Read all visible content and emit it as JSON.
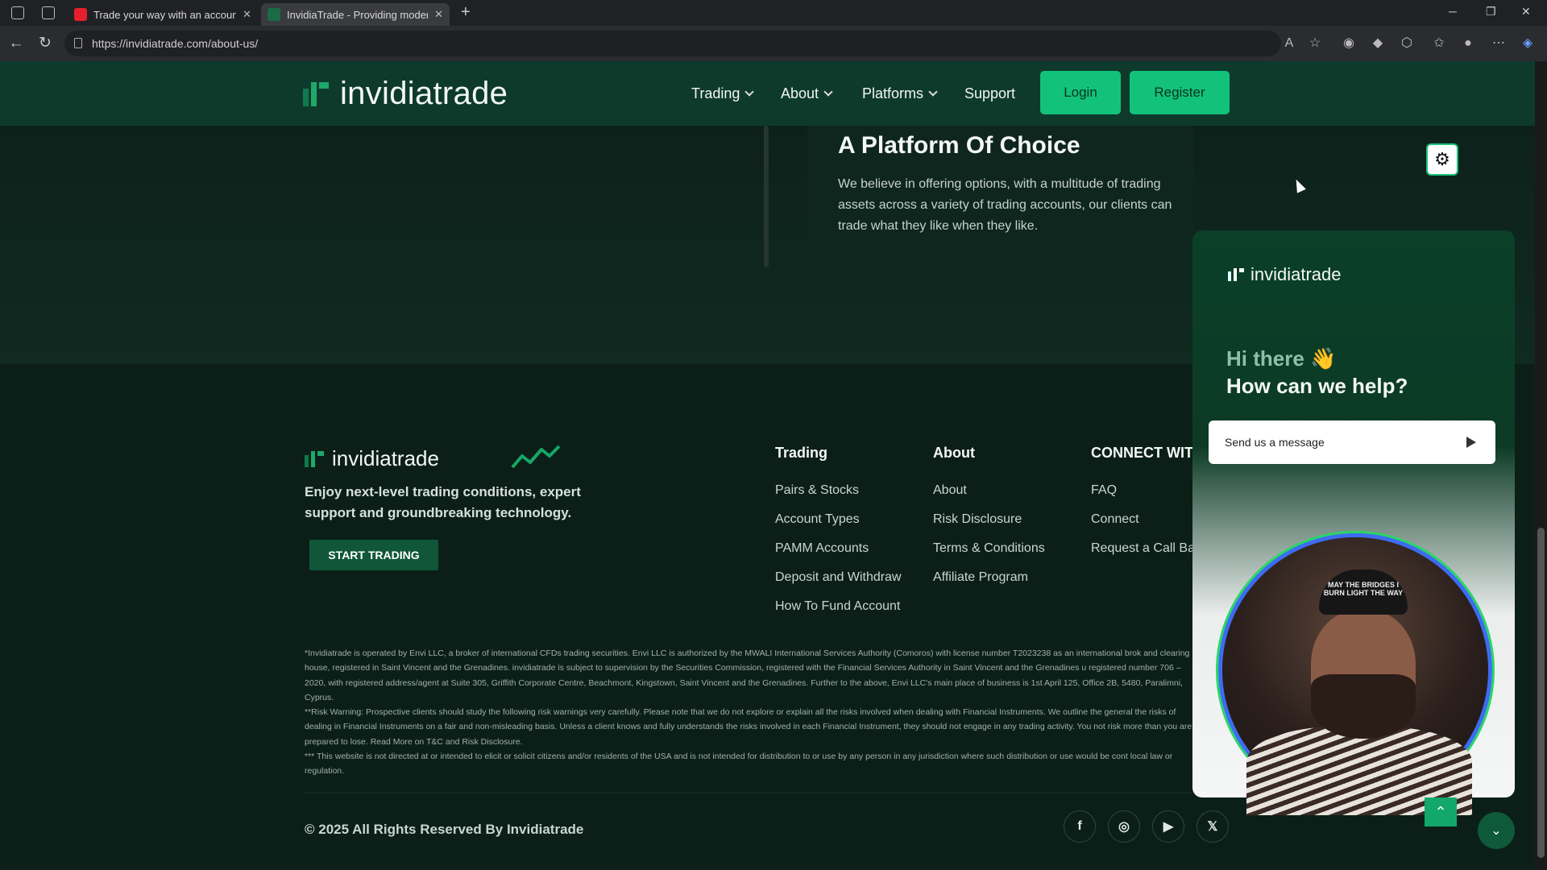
{
  "browser": {
    "tabs": [
      {
        "title": "Trade your way with an account a",
        "favicon_color": "#e4202c"
      },
      {
        "title": "InvidiaTrade - Providing modern",
        "favicon_color": "#1a6b46"
      }
    ],
    "url": "https://invidiatrade.com/about-us/"
  },
  "header": {
    "brand": "invidiatrade",
    "nav": [
      "Trading",
      "About",
      "Platforms",
      "Support"
    ],
    "login": "Login",
    "register": "Register"
  },
  "hero": {
    "title": "A Platform Of Choice",
    "text": "We believe in offering options, with a multitude of trading assets across a variety of trading accounts, our clients can trade what they like when they like."
  },
  "footer": {
    "brand": "invidiatrade",
    "tagline": "Enjoy next-level trading conditions, expert support and groundbreaking technology.",
    "cta": "START TRADING",
    "columns": [
      {
        "title": "Trading",
        "links": [
          "Pairs & Stocks",
          "Account Types",
          "PAMM Accounts",
          "Deposit and Withdraw",
          "How To Fund Account"
        ]
      },
      {
        "title": "About",
        "links": [
          "About",
          "Risk Disclosure",
          "Terms & Conditions",
          "Affiliate Program"
        ]
      },
      {
        "title": "CONNECT WITH",
        "links": [
          "FAQ",
          "Connect",
          "Request a Call Ba"
        ]
      }
    ],
    "legal": [
      "*Invidiatrade is operated by Envi LLC, a broker of international CFDs trading securities. Envi LLC is authorized by the MWALI International Services Authority (Comoros) with license number T2023238 as an international brok and clearing house, registered in Saint Vincent and the Grenadines. invidiatrade is subject to supervision by the Securities Commission, registered with the Financial Services Authority in Saint Vincent and the Grenadines u registered number 706 – 2020, with registered address/agent at Suite 305, Griffith Corporate Centre, Beachmont, Kingstown, Saint Vincent and the Grenadines. Further to the above, Envi LLC's main place of business is 1st April 125, Office 2B, 5480, Paralimni, Cyprus.",
      "**Risk Warning: Prospective clients should study the following risk warnings very carefully. Please note that we do not explore or explain all the risks involved when dealing with Financial Instruments. We outline the general the risks of dealing in Financial Instruments on a fair and non-misleading basis. Unless a client knows and fully understands the risks involved in each Financial Instrument, they should not engage in any trading activity. You not risk more than you are prepared to lose. Read More on T&C and Risk Disclosure.",
      "*** This website is not directed at or intended to elicit or solicit citizens and/or residents of the USA and is not intended for distribution to or use by any person in any jurisdiction where such distribution or use would be cont local law or regulation."
    ],
    "copyright": "© 2025 All Rights Reserved By Invidiatrade",
    "social": [
      "facebook-icon",
      "instagram-icon",
      "youtube-icon",
      "x-icon"
    ]
  },
  "chat": {
    "brand": "invidiatrade",
    "greeting": "Hi there 👋",
    "question": "How can we help?",
    "message_placeholder": "Send us a message",
    "cap_text": "MAY THE BRIDGES I BURN LIGHT THE WAY"
  },
  "colors": {
    "accent": "#13c27a",
    "header_bg": "#0e3a2c",
    "page_bg": "#0b1f18"
  }
}
